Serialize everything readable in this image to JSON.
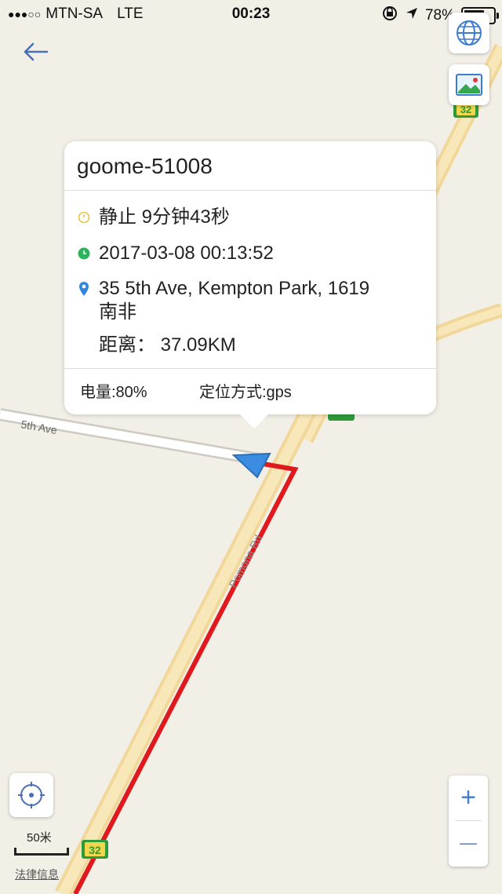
{
  "status_bar": {
    "signal": "●●●○○",
    "carrier": "MTN-SA",
    "network": "LTE",
    "time": "00:23",
    "battery": "78%",
    "battery_level": 0.78
  },
  "map": {
    "road_name": "5th Ave",
    "road_name_2": "Pomona Rd",
    "route_shield": "32",
    "route_color": "#e0191e",
    "marker_color": "#3a8de0"
  },
  "popup": {
    "device_name": "goome-51008",
    "state": "静止 9分钟43秒",
    "timestamp": "2017-03-08 00:13:52",
    "address_line1": "35 5th Ave, Kempton Park, 1619",
    "address_line2": "南非",
    "distance": "距离： 37.09KM",
    "battery": "电量:80%",
    "positioning": "定位方式:gps"
  },
  "controls": {
    "scale_label": "50米",
    "legal": "法律信息",
    "zoom_in": "+",
    "zoom_out": "—"
  }
}
